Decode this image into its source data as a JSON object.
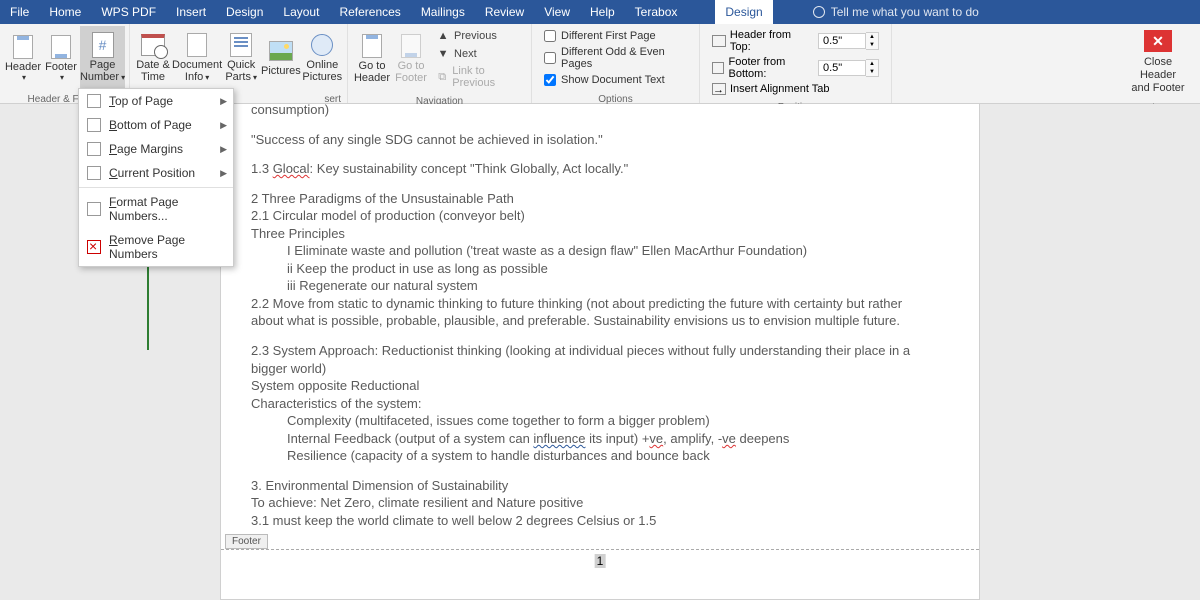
{
  "menubar": {
    "tabs": [
      "File",
      "Home",
      "WPS PDF",
      "Insert",
      "Design",
      "Layout",
      "References",
      "Mailings",
      "Review",
      "View",
      "Help",
      "Terabox"
    ],
    "contextual": "Design",
    "tellme": "Tell me what you want to do"
  },
  "ribbon": {
    "header_footer": {
      "label": "Header & Footer",
      "header": "Header",
      "footer": "Footer",
      "page_number": "Page",
      "page_number2": "Number"
    },
    "insert": {
      "label": "Insert",
      "date_time1": "Date &",
      "date_time2": "Time",
      "doc_info1": "Document",
      "doc_info2": "Info",
      "quick_parts1": "Quick",
      "quick_parts2": "Parts",
      "pictures": "Pictures",
      "online1": "Online",
      "online2": "Pictures"
    },
    "navigation": {
      "label": "Navigation",
      "goto_header1": "Go to",
      "goto_header2": "Header",
      "goto_footer1": "Go to",
      "goto_footer2": "Footer",
      "previous": "Previous",
      "next": "Next",
      "link": "Link to Previous"
    },
    "options": {
      "label": "Options",
      "diff_first": "Different First Page",
      "diff_odd": "Different Odd & Even Pages",
      "show_doc": "Show Document Text"
    },
    "position": {
      "label": "Position",
      "header_top": "Header from Top:",
      "header_top_val": "0.5\"",
      "footer_bottom": "Footer from Bottom:",
      "footer_bottom_val": "0.5\"",
      "align_tab": "Insert Alignment Tab"
    },
    "close": {
      "label": "Close",
      "line1": "Close Header",
      "line2": "and Footer"
    },
    "insert_partial": "sert"
  },
  "dropdown": {
    "items": [
      {
        "label": "Top of Page",
        "submenu": true
      },
      {
        "label": "Bottom of Page",
        "submenu": true
      },
      {
        "label": "Page Margins",
        "submenu": true
      },
      {
        "label": "Current Position",
        "submenu": true
      }
    ],
    "format": "Format Page Numbers...",
    "remove": "Remove Page Numbers"
  },
  "document": {
    "l0": "consumption)",
    "l1": "\"Success of any single SDG cannot be achieved in isolation.\"",
    "l2a": "1.3 ",
    "l2b": "Glocal",
    "l2c": ": Key sustainability concept \"Think Globally, Act locally.\"",
    "l3": "2 Three Paradigms of the Unsustainable Path",
    "l4": "2.1 Circular model of production (conveyor belt)",
    "l5": "Three Principles",
    "l6": "I Eliminate waste and pollution ('treat waste as a design flaw\" Ellen MacArthur Foundation)",
    "l7": "ii Keep the product in use as long as possible",
    "l8": "iii Regenerate our natural system",
    "l9": "2.2 Move from static to dynamic thinking to future thinking (not about predicting the future with certainty but rather about what is possible, probable, plausible, and preferable. Sustainability envisions us to envision multiple future.",
    "l10": "2.3 System Approach: Reductionist thinking (looking at individual pieces without fully understanding their place in a bigger world)",
    "l11": "System opposite Reductional",
    "l12": "Characteristics of the system:",
    "l13": "Complexity (multifaceted, issues come together to form a bigger problem)",
    "l14a": "Internal Feedback (output of a system can ",
    "l14b": "influence",
    "l14c": " its input) +",
    "l14d": "ve",
    "l14e": ", amplify, -",
    "l14f": "ve",
    "l14g": " deepens",
    "l15": "Resilience (capacity of a system to handle disturbances and bounce back",
    "l16": "3. Environmental Dimension of Sustainability",
    "l17": "To achieve: Net Zero, climate resilient and Nature positive",
    "l18": " 3.1 must keep the world climate to well below 2 degrees Celsius or 1.5",
    "footer_tab": "Footer",
    "page_num": "1"
  }
}
